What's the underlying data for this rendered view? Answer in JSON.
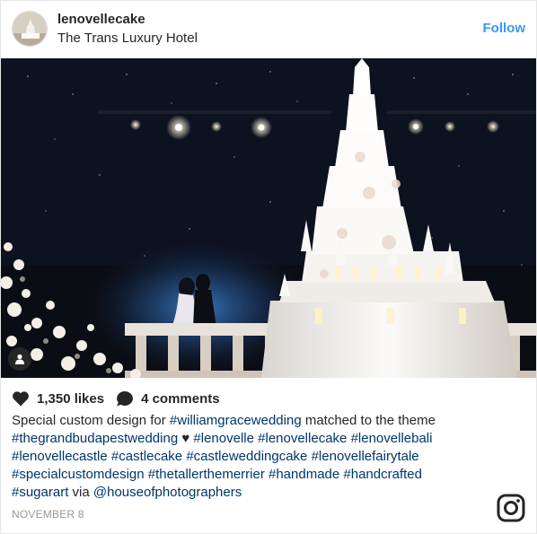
{
  "post": {
    "username": "lenovellecake",
    "location": "The Trans Luxury Hotel",
    "follow_label": "Follow",
    "likes": "1,350 likes",
    "comments": "4 comments",
    "date": "NOVEMBER 8"
  },
  "caption_lines": {
    "l1": [
      {
        "text": "Special custom design for "
      },
      {
        "text": "#williamgracewedding",
        "tag": true
      },
      {
        "text": " matched to the theme"
      }
    ],
    "l2": [
      {
        "text": "#thegrandbudapestwedding",
        "tag": true
      },
      {
        "text": " ♥ "
      },
      {
        "text": "#lenovelle",
        "tag": true
      },
      {
        "text": " "
      },
      {
        "text": "#lenovellecake",
        "tag": true
      },
      {
        "text": " "
      },
      {
        "text": "#lenovellebali",
        "tag": true
      }
    ],
    "l3": [
      {
        "text": "#lenovellecastle",
        "tag": true
      },
      {
        "text": " "
      },
      {
        "text": "#castlecake",
        "tag": true
      },
      {
        "text": " "
      },
      {
        "text": "#castleweddingcake",
        "tag": true
      },
      {
        "text": " "
      },
      {
        "text": "#lenovellefairytale",
        "tag": true
      }
    ],
    "l4": [
      {
        "text": "#specialcustomdesign",
        "tag": true
      },
      {
        "text": " "
      },
      {
        "text": "#thetallerthemerrier",
        "tag": true
      },
      {
        "text": " "
      },
      {
        "text": "#handmade",
        "tag": true
      },
      {
        "text": " "
      },
      {
        "text": "#handcrafted",
        "tag": true
      }
    ],
    "l5": [
      {
        "text": "#sugarart",
        "tag": true
      },
      {
        "text": " via "
      },
      {
        "text": "@houseofphotographers",
        "tag": true
      }
    ]
  },
  "icons": {
    "likes": "heart-icon",
    "comments": "comment-icon",
    "user_tag": "person-icon",
    "brand": "instagram-icon"
  },
  "colors": {
    "link": "#3897f0",
    "hashtag": "#003569",
    "text": "#262626",
    "muted": "#999999"
  }
}
